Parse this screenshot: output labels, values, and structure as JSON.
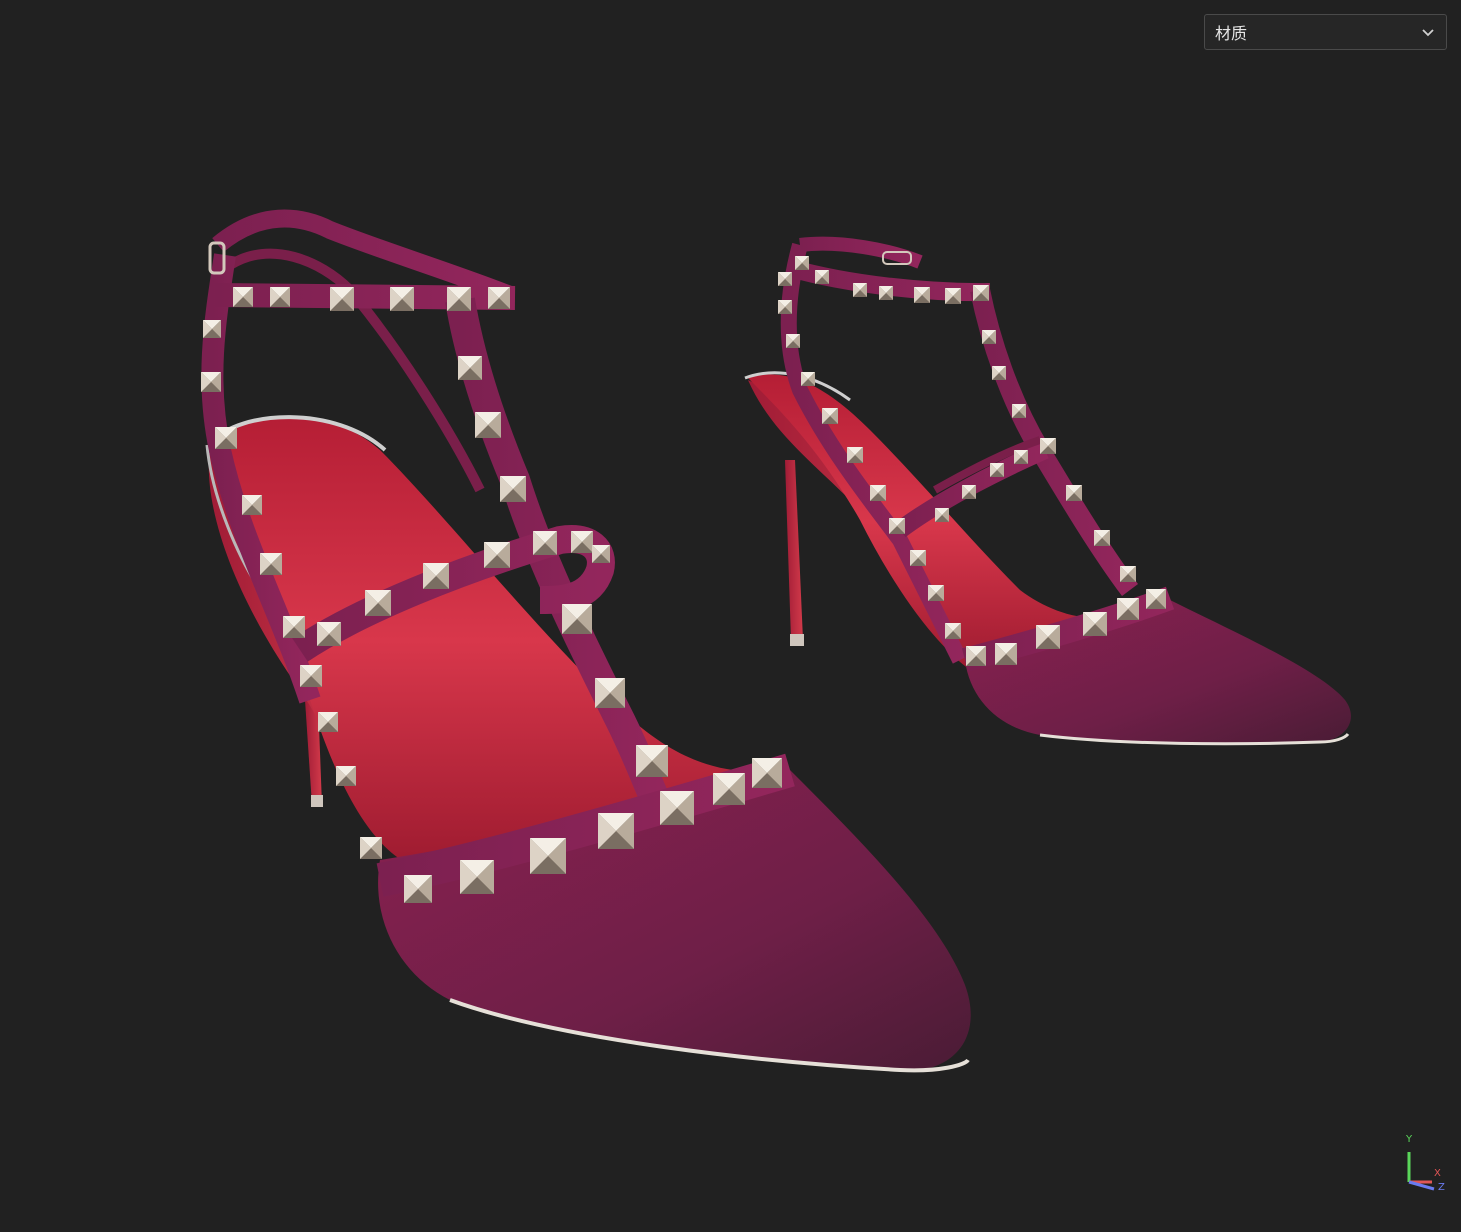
{
  "viewer": {
    "material_select": {
      "selected": "材质",
      "icon": "chevron-down-icon"
    },
    "scene": {
      "object": "pair-of-studded-pointed-toe-heels",
      "colors": {
        "background": "#212121",
        "upper": "#7a1f4a",
        "insole": "#c7253b",
        "studs": "#d8cfc4"
      }
    },
    "axis": {
      "y": "Y",
      "x": "X",
      "z": "Z",
      "colors": {
        "y": "#5ad65a",
        "x": "#e05656",
        "z": "#6a7bf0"
      }
    }
  }
}
